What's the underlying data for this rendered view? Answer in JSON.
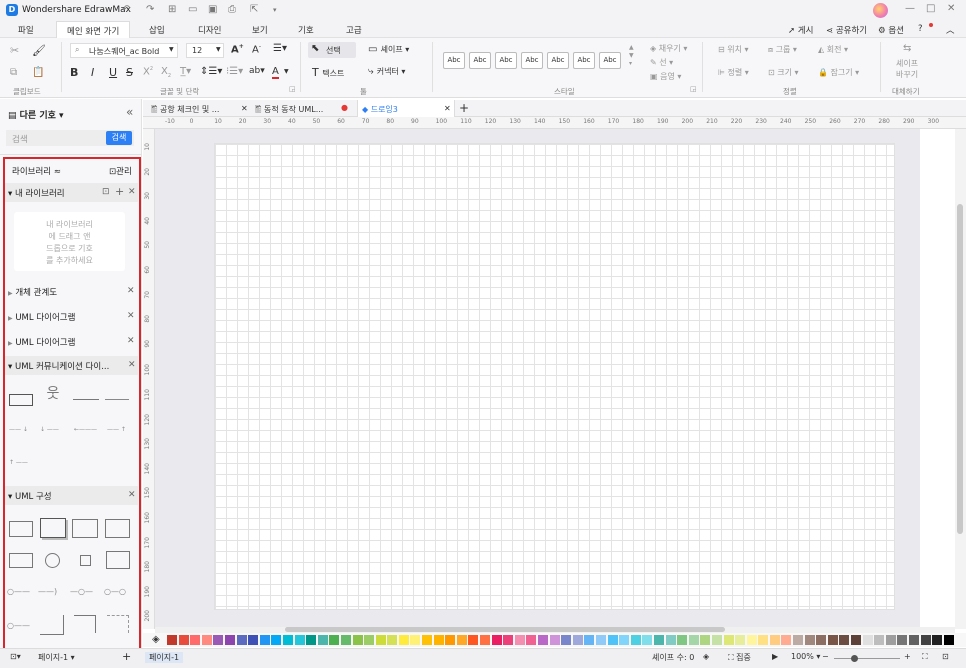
{
  "app": {
    "title": "Wondershare EdrawMax"
  },
  "titlebar": {
    "logo": "edrawmax-logo-icon",
    "window_controls": [
      "—",
      "□",
      "✕"
    ]
  },
  "menubar": {
    "items": [
      "파일",
      "메인 화면 가기",
      "삽입",
      "디자인",
      "보기",
      "기호",
      "고급"
    ],
    "right": {
      "publish": "게시",
      "share": "공유하기",
      "options": "옵션"
    }
  },
  "ribbon": {
    "clipboard_label": "클립보드",
    "font": {
      "name": "나눔스퀘어_ac Bold",
      "size": "12",
      "group_label": "글꼴 및 단락"
    },
    "tools": {
      "select": "선택",
      "shape": "셰이프",
      "text": "텍스트",
      "connector": "커넥터",
      "group_label": "툴"
    },
    "style": {
      "boxes": [
        "Abc",
        "Abc",
        "Abc",
        "Abc",
        "Abc",
        "Abc",
        "Abc"
      ],
      "fill": "채우기",
      "line": "선",
      "shadow": "음영",
      "group_label": "스타일"
    },
    "arrange": {
      "position": "위치",
      "group": "그룹",
      "rotate": "회전",
      "align": "정렬",
      "size": "크기",
      "lock": "잠그기",
      "group_label": "정렬"
    },
    "replace": {
      "label1": "셰이프",
      "label2": "바꾸기",
      "group_label": "대체하기"
    }
  },
  "left_panel": {
    "title": "다른 기호",
    "search_placeholder": "검색",
    "search_button": "검색",
    "library_label": "라이브러리",
    "manage_label": "관리",
    "my_library": "내 라이브러리",
    "my_library_hint": [
      "내 라이브러리",
      "에 드래그 앤",
      "드롭으로 기호",
      "를 추가하세요"
    ],
    "sections": [
      "개체 관계도",
      "UML 다이어그램",
      "UML 다이어그램"
    ],
    "uml_comm": "UML 커뮤니케이션 다이...",
    "uml_struct": "UML 구성"
  },
  "tabs": [
    {
      "label": "공항 체크인 및 ..."
    },
    {
      "label": "동적 동작 UML..."
    },
    {
      "label": "드로잉3"
    }
  ],
  "ruler": {
    "h_ticks": [
      "-10",
      "0",
      "10",
      "20",
      "30",
      "40",
      "50",
      "60",
      "70",
      "80",
      "90",
      "100",
      "110",
      "120",
      "130",
      "140",
      "150",
      "160",
      "170",
      "180",
      "190",
      "200",
      "210",
      "220",
      "230",
      "240",
      "250",
      "260",
      "270",
      "280",
      "290",
      "300"
    ],
    "v_ticks": [
      "10",
      "20",
      "30",
      "40",
      "50",
      "60",
      "70",
      "80",
      "90",
      "100",
      "110",
      "120",
      "130",
      "140",
      "150",
      "160",
      "170",
      "180",
      "190",
      "200"
    ]
  },
  "palette": {
    "colors": [
      "#c0392b",
      "#e74c3c",
      "#ff6b6b",
      "#ff8a80",
      "#9b59b6",
      "#8e44ad",
      "#5c6bc0",
      "#3f51b5",
      "#2196f3",
      "#03a9f4",
      "#00bcd4",
      "#26c6da",
      "#009688",
      "#4db6ac",
      "#4caf50",
      "#66bb6a",
      "#8bc34a",
      "#9ccc65",
      "#cddc39",
      "#d4e157",
      "#ffeb3b",
      "#fff176",
      "#ffc107",
      "#ffb300",
      "#ff9800",
      "#ffa726",
      "#ff5722",
      "#ff7043",
      "#e91e63",
      "#ec407a",
      "#f48fb1",
      "#f06292",
      "#ba68c8",
      "#ce93d8",
      "#7986cb",
      "#9fa8da",
      "#64b5f6",
      "#90caf9",
      "#4fc3f7",
      "#81d4fa",
      "#4dd0e1",
      "#80deea",
      "#4db6ac",
      "#80cbc4",
      "#81c784",
      "#a5d6a7",
      "#aed581",
      "#c5e1a5",
      "#dce775",
      "#e6ee9c",
      "#fff59d",
      "#ffe082",
      "#ffcc80",
      "#ffab91",
      "#bcaaa4",
      "#a1887f",
      "#8d6e63",
      "#795548",
      "#6d4c41",
      "#5d4037",
      "#e0e0e0",
      "#bdbdbd",
      "#9e9e9e",
      "#757575",
      "#616161",
      "#424242",
      "#212121",
      "#000000"
    ]
  },
  "status": {
    "page": "페이지-1",
    "page_tab": "페이지-1",
    "shape_count": "셰이프 수: 0",
    "focus": "집중",
    "zoom": "100%"
  }
}
